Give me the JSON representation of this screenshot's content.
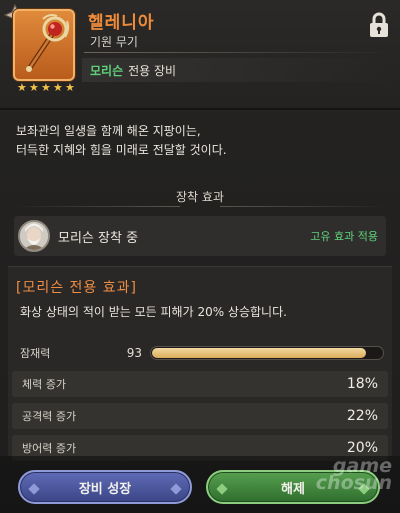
{
  "item": {
    "name": "헬레니아",
    "type": "기원 무기",
    "exclusive_hero": "모리슨",
    "exclusive_label": "전용 장비",
    "stars": 5,
    "icon": "scepter-icon",
    "locked": true
  },
  "description": {
    "line1": "보좌관의 일생을 함께 해온 지팡이는,",
    "line2": "터득한 지혜와 힘을 미래로 전달할 것이다."
  },
  "equip_section": {
    "title": "장착 효과",
    "hero_equipped_text": "모리슨 장착 중",
    "status": "고유 효과 적용"
  },
  "exclusive_effect": {
    "title": "[모리슨 전용 효과]",
    "description": "화상 상태의 적이 받는 모든 피해가 20% 상승합니다."
  },
  "stats": {
    "potential_label": "잠재력",
    "potential_value": "93",
    "potential_fraction": 0.93,
    "rows": [
      {
        "label": "체력 증가",
        "value": "18%"
      },
      {
        "label": "공격력 증가",
        "value": "22%"
      },
      {
        "label": "방어력 증가",
        "value": "20%"
      }
    ]
  },
  "buttons": {
    "growth": "장비 성장",
    "release": "해제"
  },
  "watermark": {
    "line1": "game",
    "line2": "chosun"
  },
  "colors": {
    "accent_orange": "#f08b3a",
    "hero_green": "#5ed27a",
    "star_gold": "#f0c24c",
    "growth_blue": "#4a56a0",
    "release_green": "#3f8a3c"
  }
}
